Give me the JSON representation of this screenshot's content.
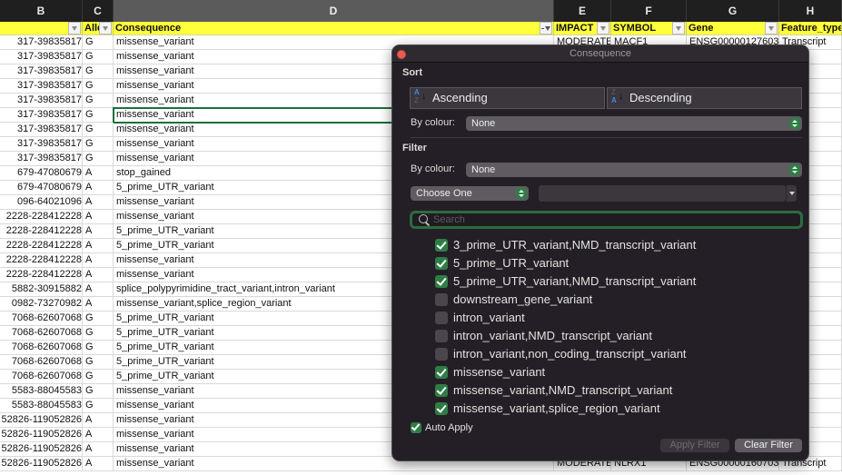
{
  "sheet": {
    "column_letters": [
      "B",
      "C",
      "D",
      "E",
      "F",
      "G",
      "H"
    ],
    "headers": [
      "",
      "Alle",
      "Consequence",
      "IMPACT",
      "SYMBOL",
      "Gene",
      "Feature_type"
    ],
    "rows": [
      [
        "317-39835817",
        "G",
        "missense_variant",
        "MODERATE",
        "MACF1",
        "ENSG00000127603",
        "Transcript"
      ],
      [
        "317-39835817",
        "G",
        "missense_variant",
        "",
        "",
        "",
        "pt"
      ],
      [
        "317-39835817",
        "G",
        "missense_variant",
        "",
        "",
        "",
        "pt"
      ],
      [
        "317-39835817",
        "G",
        "missense_variant",
        "",
        "",
        "",
        "pt"
      ],
      [
        "317-39835817",
        "G",
        "missense_variant",
        "",
        "",
        "",
        "pt"
      ],
      [
        "317-39835817",
        "G",
        "missense_variant",
        "",
        "",
        "",
        "pt"
      ],
      [
        "317-39835817",
        "G",
        "missense_variant",
        "",
        "",
        "",
        "pt"
      ],
      [
        "317-39835817",
        "G",
        "missense_variant",
        "",
        "",
        "",
        "pt"
      ],
      [
        "317-39835817",
        "G",
        "missense_variant",
        "",
        "",
        "",
        "pt"
      ],
      [
        "679-47080679",
        "A",
        "stop_gained",
        "",
        "",
        "",
        "pt"
      ],
      [
        "679-47080679",
        "A",
        "5_prime_UTR_variant",
        "",
        "",
        "",
        "pt"
      ],
      [
        "096-64021096",
        "A",
        "missense_variant",
        "",
        "",
        "",
        "pt"
      ],
      [
        "2228-228412228",
        "A",
        "missense_variant",
        "",
        "",
        "",
        "pt"
      ],
      [
        "2228-228412228",
        "A",
        "5_prime_UTR_variant",
        "",
        "",
        "",
        "pt"
      ],
      [
        "2228-228412228",
        "A",
        "5_prime_UTR_variant",
        "",
        "",
        "",
        "pt"
      ],
      [
        "2228-228412228",
        "A",
        "missense_variant",
        "",
        "",
        "",
        "pt"
      ],
      [
        "2228-228412228",
        "A",
        "missense_variant",
        "",
        "",
        "",
        "pt"
      ],
      [
        "5882-30915882",
        "A",
        "splice_polypyrimidine_tract_variant,intron_variant",
        "",
        "",
        "",
        "pt"
      ],
      [
        "0982-73270982",
        "A",
        "missense_variant,splice_region_variant",
        "",
        "",
        "",
        "pt"
      ],
      [
        "7068-62607068",
        "G",
        "5_prime_UTR_variant",
        "",
        "",
        "",
        "pt"
      ],
      [
        "7068-62607068",
        "G",
        "5_prime_UTR_variant",
        "",
        "",
        "",
        "pt"
      ],
      [
        "7068-62607068",
        "G",
        "5_prime_UTR_variant",
        "",
        "",
        "",
        "pt"
      ],
      [
        "7068-62607068",
        "G",
        "5_prime_UTR_variant",
        "",
        "",
        "",
        "pt"
      ],
      [
        "7068-62607068",
        "G",
        "5_prime_UTR_variant",
        "",
        "",
        "",
        "pt"
      ],
      [
        "5583-88045583",
        "G",
        "missense_variant",
        "",
        "",
        "",
        "pt"
      ],
      [
        "5583-88045583",
        "G",
        "missense_variant",
        "",
        "",
        "",
        "pt"
      ],
      [
        "52826-119052826",
        "A",
        "missense_variant",
        "",
        "",
        "",
        "pt"
      ],
      [
        "52826-119052826",
        "A",
        "missense_variant",
        "",
        "",
        "",
        "pt"
      ],
      [
        "52826-119052826",
        "A",
        "missense_variant",
        "",
        "",
        "",
        "pt"
      ],
      [
        "52826-119052826",
        "A",
        "missense_variant",
        "MODERATE",
        "NLRX1",
        "ENSG00000160703",
        "Transcript"
      ]
    ],
    "selected_row_index": 5
  },
  "dialog": {
    "title": "Consequence",
    "sort": {
      "title": "Sort",
      "ascending_label": "Ascending",
      "descending_label": "Descending",
      "by_colour_label": "By colour:",
      "by_colour_value": "None"
    },
    "filter": {
      "title": "Filter",
      "by_colour_label": "By colour:",
      "by_colour_value": "None",
      "condition_value": "Choose One",
      "condition_input_value": "",
      "search_placeholder": "Search",
      "items": [
        {
          "label": "3_prime_UTR_variant,NMD_transcript_variant",
          "checked": true
        },
        {
          "label": "5_prime_UTR_variant",
          "checked": true
        },
        {
          "label": "5_prime_UTR_variant,NMD_transcript_variant",
          "checked": true
        },
        {
          "label": "downstream_gene_variant",
          "checked": false
        },
        {
          "label": "intron_variant",
          "checked": false
        },
        {
          "label": "intron_variant,NMD_transcript_variant",
          "checked": false
        },
        {
          "label": "intron_variant,non_coding_transcript_variant",
          "checked": false
        },
        {
          "label": "missense_variant",
          "checked": true
        },
        {
          "label": "missense_variant,NMD_transcript_variant",
          "checked": true
        },
        {
          "label": "missense_variant,splice_region_variant",
          "checked": true
        }
      ],
      "auto_apply_label": "Auto Apply",
      "auto_apply_checked": true,
      "apply_label": "Apply Filter",
      "clear_label": "Clear Filter"
    }
  },
  "colors": {
    "header_yellow": "#ffff3b",
    "accent_green": "#2f7d46",
    "dialog_bg": "#241f26",
    "close_red": "#ed5a55"
  }
}
